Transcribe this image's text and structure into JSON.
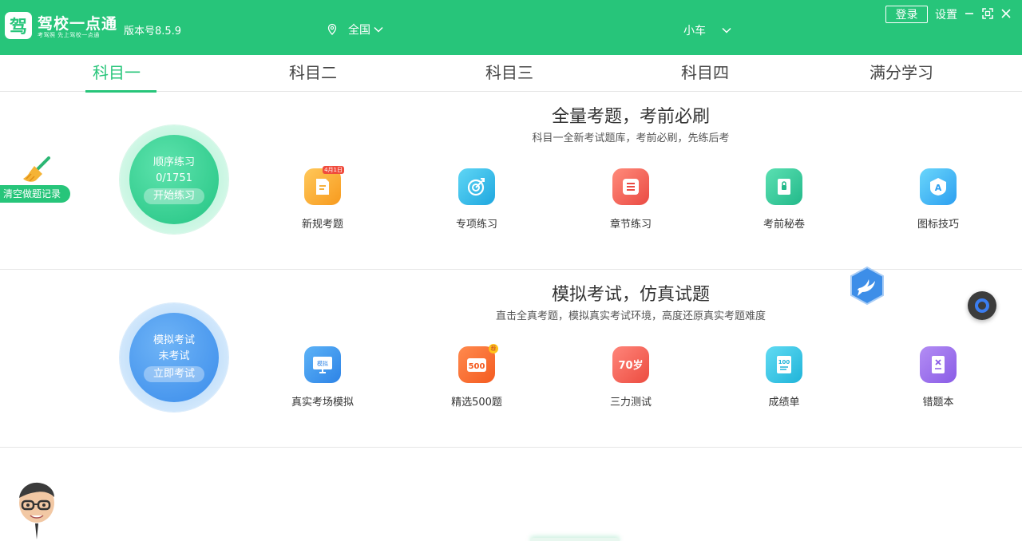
{
  "header": {
    "logo_char": "驾",
    "brand_name": "驾校一点通",
    "brand_slogan": "考驾照 先上驾校一点通",
    "version": "版本号8.5.9",
    "region": "全国",
    "vehicle": "小车",
    "login_label": "登录",
    "settings_label": "设置"
  },
  "tabs": [
    {
      "label": "科目一",
      "active": true
    },
    {
      "label": "科目二",
      "active": false
    },
    {
      "label": "科目三",
      "active": false
    },
    {
      "label": "科目四",
      "active": false
    },
    {
      "label": "满分学习",
      "active": false
    }
  ],
  "practice": {
    "title": "全量考题，考前必刷",
    "subtitle": "科目一全新考试题库，考前必刷，先练后考",
    "circle": {
      "line1": "顺序练习",
      "line2": "0/1751",
      "button": "开始练习"
    },
    "features": [
      {
        "label": "新规考题",
        "icon": "doc-icon",
        "badge": "4月1日"
      },
      {
        "label": "专项练习",
        "icon": "target-icon"
      },
      {
        "label": "章节练习",
        "icon": "list-icon"
      },
      {
        "label": "考前秘卷",
        "icon": "secret-paper-icon"
      },
      {
        "label": "图标技巧",
        "icon": "sign-icon",
        "icon_letter": "A"
      }
    ]
  },
  "exam": {
    "title": "模拟考试，仿真试题",
    "subtitle": "直击全真考题，模拟真实考试环境，高度还原真实考题难度",
    "circle": {
      "line1": "模拟考试",
      "line2": "未考试",
      "button": "立即考试"
    },
    "features": [
      {
        "label": "真实考场模拟",
        "icon": "monitor-icon",
        "icon_text": "模拟"
      },
      {
        "label": "精选500题",
        "icon": "500-icon",
        "icon_text": "500",
        "badge": "荐"
      },
      {
        "label": "三力测试",
        "icon": "age70-icon",
        "icon_text": "70岁"
      },
      {
        "label": "成绩单",
        "icon": "score-card-icon",
        "icon_text": "100"
      },
      {
        "label": "错题本",
        "icon": "wrong-book-icon"
      }
    ]
  },
  "sidebar": {
    "clear_record": "清空做题记录"
  },
  "colors": {
    "brand": "#27c57a",
    "blue": "#3a8ceb",
    "text": "#333333"
  }
}
